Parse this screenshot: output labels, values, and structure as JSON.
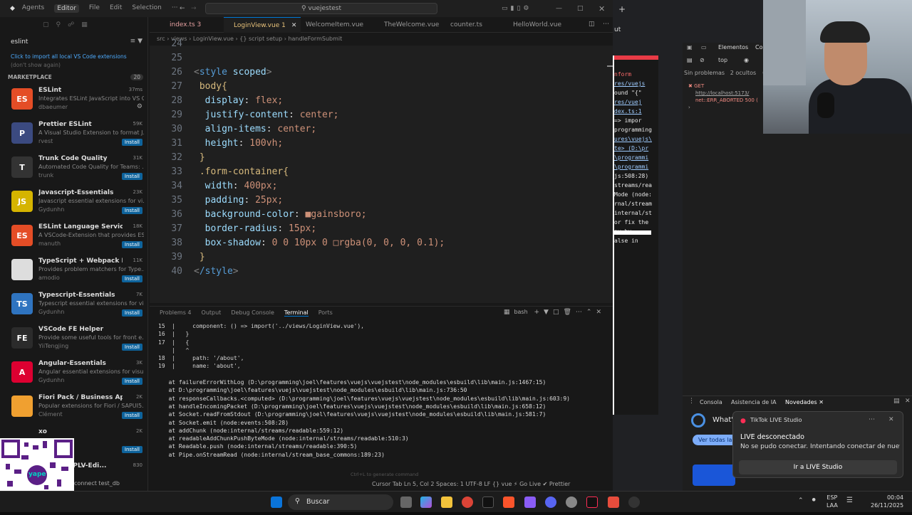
{
  "titlebar": {
    "menu": [
      "Agents",
      "Editor",
      "File",
      "Edit",
      "Selection",
      "···"
    ],
    "search": "vuejestest"
  },
  "sidebar": {
    "search_value": "eslint",
    "import_hint": "Click to import all local VS Code extensions",
    "import_hint_dim": "(don't show again)",
    "section": "MARKETPLACE",
    "count": "20",
    "extensions": [
      {
        "name": "ESLint",
        "desc": "Integrates ESLint JavaScript into VS C...",
        "pub": "dbaeumer",
        "meta": "37ms",
        "logo": "ES",
        "color": "#e44d26",
        "installed": true
      },
      {
        "name": "Prettier ESLint",
        "desc": "A Visual Studio Extension to format J...",
        "pub": "rvest",
        "meta": "59K",
        "logo": "P",
        "color": "#3b4a80",
        "installed": false
      },
      {
        "name": "Trunk Code Quality",
        "desc": "Automated Code Quality for Teams: ...",
        "pub": "trunk",
        "meta": "31K",
        "logo": "T",
        "color": "#333",
        "installed": false
      },
      {
        "name": "Javascript-Essentials",
        "desc": "Javascript essential extensions for vi...",
        "pub": "Gydunhn",
        "meta": "23K",
        "logo": "JS",
        "color": "#d5b400",
        "installed": false
      },
      {
        "name": "ESLint Language Service",
        "desc": "A VSCode-Extension that provides ES...",
        "pub": "manuth",
        "meta": "18K",
        "logo": "ES",
        "color": "#e44d26",
        "installed": false
      },
      {
        "name": "TypeScript + Webpack Pro...",
        "desc": "Provides problem matchers for Type...",
        "pub": "amodio",
        "meta": "11K",
        "logo": "",
        "color": "#ddd",
        "installed": false
      },
      {
        "name": "Typescript-Essentials",
        "desc": "Typescript essential extensions for vi...",
        "pub": "Gydunhn",
        "meta": "7K",
        "logo": "TS",
        "color": "#2f74c0",
        "installed": false
      },
      {
        "name": "VSCode FE Helper",
        "desc": "Provide some useful tools for front e...",
        "pub": "YiiTengjing",
        "meta": "",
        "logo": "FE",
        "color": "#2b2b2b",
        "installed": false
      },
      {
        "name": "Angular-Essentials",
        "desc": "Angular essential extensions for visu...",
        "pub": "Gydunhn",
        "meta": "3K",
        "logo": "A",
        "color": "#dd0031",
        "installed": false
      },
      {
        "name": "Fiori Pack / Business Applic...",
        "desc": "Popular extensions for Fiori / SAPUI5...",
        "pub": "Clément",
        "meta": "2K",
        "logo": "",
        "color": "#f0a030",
        "installed": false
      },
      {
        "name": "xo",
        "desc": "",
        "pub": "",
        "meta": "2K",
        "logo": "",
        "color": "#181818",
        "installed": false
      },
      {
        "name": "...entials-PLV-Edi...",
        "desc": "",
        "pub": "",
        "meta": "830",
        "logo": "",
        "color": "#181818",
        "installed": false
      }
    ],
    "install_label": "Install",
    "footer": "connect  test_db"
  },
  "tabs": [
    {
      "label": "index.ts 3",
      "x": 0
    },
    {
      "label": "LoginView.vue 1",
      "active": true
    },
    {
      "label": "WelcomeItem.vue"
    },
    {
      "label": "TheWelcome.vue"
    },
    {
      "label": "counter.ts"
    },
    {
      "label": "HelloWorld.vue"
    }
  ],
  "breadcrumb": "src › views › LoginView.vue › {} script setup › handleFormSubmit",
  "code": [
    {
      "n": "24",
      "t": ""
    },
    {
      "n": "25",
      "t": ""
    },
    {
      "n": "26",
      "t": "<style scoped>"
    },
    {
      "n": "27",
      "t": " body{"
    },
    {
      "n": "28",
      "t": "  display: flex;"
    },
    {
      "n": "29",
      "t": "  justify-content: center;"
    },
    {
      "n": "30",
      "t": "  align-items: center;"
    },
    {
      "n": "31",
      "t": "  height: 100vh;"
    },
    {
      "n": "32",
      "t": " }"
    },
    {
      "n": "33",
      "t": " .form-container{"
    },
    {
      "n": "34",
      "t": "  width: 400px;"
    },
    {
      "n": "35",
      "t": "  padding: 25px;"
    },
    {
      "n": "36",
      "t": "  background-color: ■gainsboro;"
    },
    {
      "n": "37",
      "t": "  border-radius: 15px;"
    },
    {
      "n": "38",
      "t": "  box-shadow: 0 0 10px 0 □rgba(0, 0, 0, 0.1);"
    },
    {
      "n": "39",
      "t": " }"
    },
    {
      "n": "40",
      "t": "</style>"
    }
  ],
  "panel": {
    "tabs": [
      "Problems 4",
      "Output",
      "Debug Console",
      "Terminal",
      "Ports"
    ],
    "shell": "bash",
    "terminal": [
      "15  |     component: () => import('../views/LoginView.vue'),",
      "16  |   }",
      "17  |   {",
      "    |   ^",
      "18  |     path: '/about',",
      "19  |     name: 'about',",
      "",
      "   at failureErrorWithLog (D:\\programming\\joel\\features\\vuejs\\vuejstest\\node_modules\\esbuild\\lib\\main.js:1467:15)",
      "   at D:\\programming\\joel\\features\\vuejs\\vuejstest\\node_modules\\esbuild\\lib\\main.js:736:50",
      "   at responseCallbacks.<computed> (D:\\programming\\joel\\features\\vuejs\\vuejstest\\node_modules\\esbuild\\lib\\main.js:603:9)",
      "   at handleIncomingPacket (D:\\programming\\joel\\features\\vuejs\\vuejstest\\node_modules\\esbuild\\lib\\main.js:658:12)",
      "   at Socket.readFromStdout (D:\\programming\\joel\\features\\vuejs\\vuejstest\\node_modules\\esbuild\\lib\\main.js:581:7)",
      "   at Socket.emit (node:events:508:28)",
      "   at addChunk (node:internal/streams/readable:559:12)",
      "   at readableAddChunkPushByteMode (node:internal/streams/readable:510:3)",
      "   at Readable.push (node:internal/streams/readable:390:5)",
      "   at Pipe.onStreamRead (node:internal/stream_base_commons:189:23)"
    ]
  },
  "statusbar": {
    "left": "Cursor Tab   Ln 5, Col 2   Spaces: 1   UTF-8   LF   {} vue   ⚡ Go Live   ✔ Prettier"
  },
  "browser": {
    "tab_suffix": "ut",
    "devtools_tabs": [
      "Elementos",
      "Co"
    ],
    "filter": "top",
    "issues": "Sin problemas",
    "hidden": "2 ocultos",
    "error_get": "GET",
    "error_url": "http://localhost:5173/",
    "error_msg": "net::ERR_ABORTED 500 (",
    "drawer_tabs": [
      "Consola",
      "Asistencia de IA",
      "Novedades"
    ],
    "whats": "What'",
    "see_all": "Ver todas las",
    "page_lines": [
      "nform",
      "res/vuejs",
      "ound \"{\"",
      "res/vuej",
      "dex.ts:1",
      "=> impor",
      "programming",
      "ures\\vuejs\\",
      "te> (D:\\pr",
      "\\programmi",
      "\\programmi",
      "js:508:28)",
      "streams/rea",
      "Mode (node:",
      "rnal/stream",
      "internal/st",
      "or fix the",
      "ay by",
      "alse in"
    ]
  },
  "toast": {
    "app": "TikTok LIVE Studio",
    "title": "LIVE desconectado",
    "body": "No se pudo conectar. Intentando conectar de nuevo...",
    "button": "Ir a LIVE Studio"
  },
  "taskbar": {
    "search": "Buscar",
    "lang": "ESP",
    "lang2": "LAA",
    "time": "00:04",
    "date": "26/11/2025"
  }
}
